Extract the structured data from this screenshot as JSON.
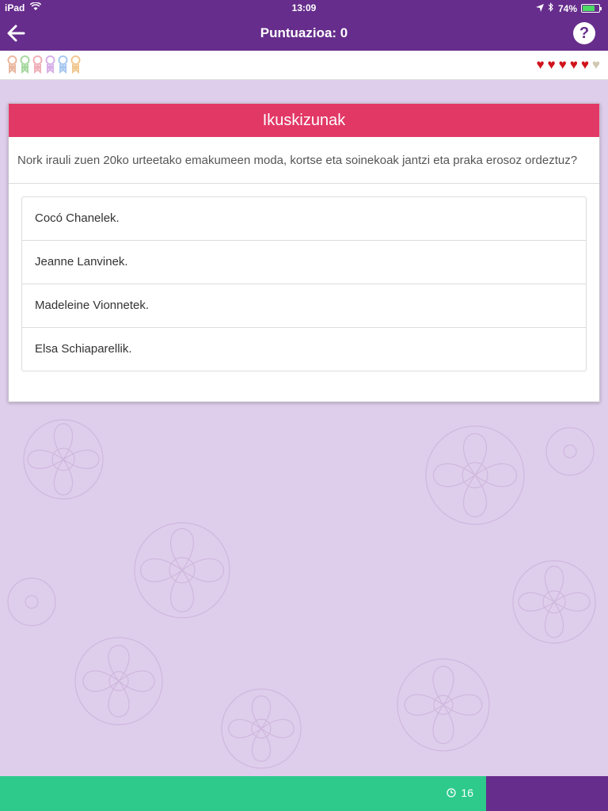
{
  "status_bar": {
    "carrier": "iPad",
    "time": "13:09",
    "battery": "74%",
    "battery_level": 0.74
  },
  "nav": {
    "title": "Puntuazioa: 0",
    "back_icon": "arrow-left-icon",
    "help_label": "?"
  },
  "badges": {
    "colors": [
      "#e8b8a0",
      "#a8d8a0",
      "#f0b0b8",
      "#d8b0e8",
      "#a8c8f0",
      "#f0c890"
    ]
  },
  "lives": {
    "total": 6,
    "remaining": 5,
    "full_color": "#d0141c",
    "empty_color": "#cfc7b0"
  },
  "card": {
    "category": "Ikuskizunak",
    "category_color": "#e23866",
    "question": "Nork irauli zuen 20ko urteetako emakumeen moda, kortse eta soinekoak jantzi eta praka erosoz ordeztuz?",
    "answers": [
      "Cocó Chanelek.",
      "Jeanne Lanvinek.",
      "Madeleine Vionnetek.",
      "Elsa Schiaparellik."
    ]
  },
  "timer": {
    "seconds": "16",
    "progress": 0.8,
    "bar_color": "#2dca8c",
    "icon": "clock-icon"
  },
  "theme": {
    "primary": "#662d8c"
  }
}
